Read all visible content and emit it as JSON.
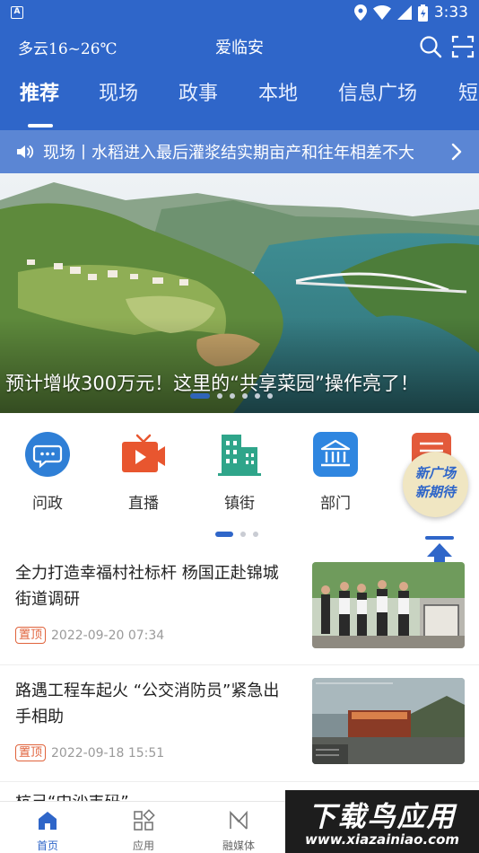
{
  "status_bar": {
    "time": "3:33",
    "notification_icon_letter": "A"
  },
  "app_bar": {
    "weather": "多云16~26℃",
    "title": "爱临安"
  },
  "tabs": [
    "推荐",
    "现场",
    "政事",
    "本地",
    "信息广场",
    "短"
  ],
  "active_tab": 0,
  "notice": {
    "text": "现场丨水稻进入最后灌浆结实期亩产和往年相差不大"
  },
  "banner": {
    "caption": "预计增收300万元！这里的“共享菜园”操作亮了！",
    "slide_count": 6,
    "active_slide": 0
  },
  "quick_entries": [
    {
      "label": "问政",
      "icon": "chat-bubble-icon",
      "color": "#2f7fd6"
    },
    {
      "label": "直播",
      "icon": "live-tv-icon",
      "color": "#e8562f"
    },
    {
      "label": "镇街",
      "icon": "buildings-icon",
      "color": "#2fa58a"
    },
    {
      "label": "部门",
      "icon": "government-building-icon",
      "color": "#2f86e0"
    },
    {
      "label": "",
      "icon": "document-icon",
      "color": "#e35a3a"
    }
  ],
  "floating_badge": {
    "line1": "新广场",
    "line2": "新期待"
  },
  "quick_pager": {
    "count": 3,
    "active": 0
  },
  "news": [
    {
      "title": "全力打造幸福村社标杆 杨国正赴锦城街道调研",
      "tag": "置顶",
      "date": "2022-09-20 07:34",
      "thumb": "officials-visit-photo"
    },
    {
      "title": "路遇工程车起火 “公交消防员”紧急出手相助",
      "tag": "置顶",
      "date": "2022-09-18 15:51",
      "thumb": "bus-dashcam-photo"
    },
    {
      "title": "杭己“中沙丰码”...",
      "tag": "",
      "date": "",
      "thumb": ""
    }
  ],
  "bottom_nav": [
    {
      "label": "首页",
      "icon": "home-icon"
    },
    {
      "label": "应用",
      "icon": "apps-grid-icon"
    },
    {
      "label": "融媒体",
      "icon": "media-icon"
    }
  ],
  "watermark": {
    "line1": "下载鸟应用",
    "line2": "www.xiazainiao.com"
  },
  "colors": {
    "primary": "#2f66c9",
    "notice_bg": "#5b86d4",
    "pin": "#e0633c"
  }
}
